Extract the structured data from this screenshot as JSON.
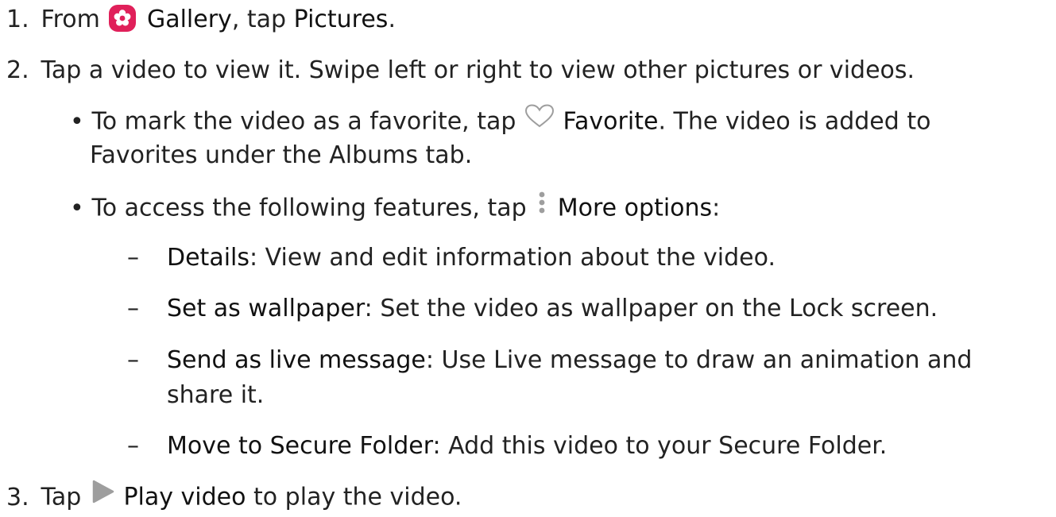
{
  "step1": {
    "number": "1.",
    "text_before": "From",
    "app_name": "Gallery",
    "text_middle": ", tap",
    "tab_name": "Pictures",
    "text_after": "."
  },
  "step2": {
    "number": "2.",
    "text": "Tap a video to view it. Swipe left or right to view other pictures or videos."
  },
  "bullet1": {
    "bullet": "•",
    "text_before": "To mark the video as a favorite, tap",
    "button_label": "Favorite",
    "text_after": ". The video is added to",
    "continuation": "Favorites under the Albums tab."
  },
  "bullet2": {
    "bullet": "•",
    "text_before": "To access the following features, tap",
    "button_label": "More options",
    "text_after": ":"
  },
  "subitems": [
    {
      "dash": "–",
      "label": "Details",
      "text": ": View and edit information about the video."
    },
    {
      "dash": "–",
      "label": "Set as wallpaper",
      "text": ": Set the video as wallpaper on the Lock screen."
    },
    {
      "dash": "–",
      "label": "Send as live message",
      "text": ": Use Live message to draw an animation and",
      "continuation": "share it."
    },
    {
      "dash": "–",
      "label": "Move to Secure Folder",
      "text": ": Add this video to your Secure Folder."
    }
  ],
  "step3": {
    "number": "3.",
    "text_before": "Tap",
    "button_label": "Play video",
    "text_after": "to play the video."
  },
  "icons": {
    "gallery": "gallery-flower-icon",
    "favorite": "heart-outline-icon",
    "more_options": "vertical-dots-icon",
    "play": "play-triangle-icon"
  },
  "colors": {
    "gallery_icon_bg": "#e0205a",
    "icon_gray": "#9e9e9e",
    "text": "#222222"
  }
}
